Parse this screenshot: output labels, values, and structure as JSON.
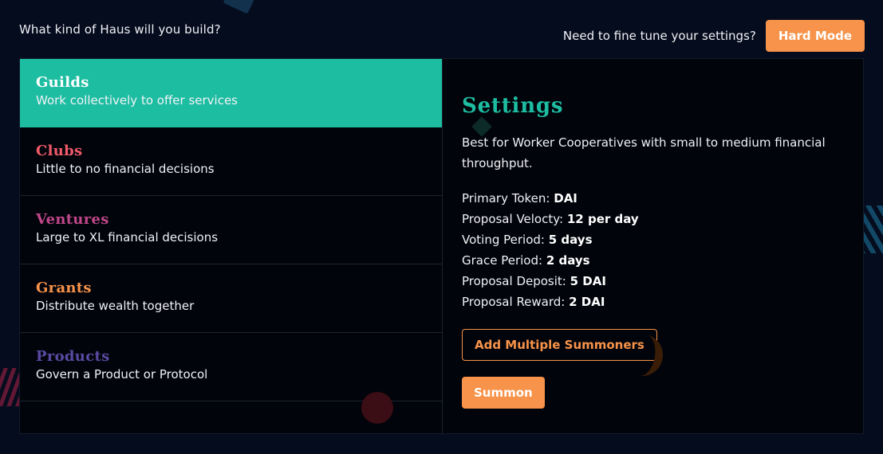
{
  "header": {
    "question": "What kind of Haus will you build?",
    "finetune_prompt": "Need to fine tune your settings?",
    "hard_mode_label": "Hard Mode"
  },
  "colors": {
    "background": "#050c1d",
    "accent_teal": "#1dbda2",
    "accent_orange": "#f7934a",
    "clubs": "#f05a6b",
    "ventures": "#c0478a",
    "grants": "#f7934a",
    "products": "#5a4aa3"
  },
  "haus_types": [
    {
      "title": "Guilds",
      "description": "Work collectively to offer services",
      "color": "#ffffff",
      "selected": true
    },
    {
      "title": "Clubs",
      "description": "Little to no financial decisions",
      "color": "#f05a6b",
      "selected": false
    },
    {
      "title": "Ventures",
      "description": "Large to XL financial decisions",
      "color": "#c0478a",
      "selected": false
    },
    {
      "title": "Grants",
      "description": "Distribute wealth together",
      "color": "#f7934a",
      "selected": false
    },
    {
      "title": "Products",
      "description": "Govern a Product or Protocol",
      "color": "#5a4aa3",
      "selected": false
    }
  ],
  "settings": {
    "title": "Settings",
    "description": "Best for Worker Cooperatives with small to medium financial throughput.",
    "params": [
      {
        "label": "Primary Token:",
        "value": "DAI"
      },
      {
        "label": "Proposal Velocty:",
        "value": "12 per day"
      },
      {
        "label": "Voting Period:",
        "value": "5 days"
      },
      {
        "label": "Grace Period:",
        "value": "2 days"
      },
      {
        "label": "Proposal Deposit:",
        "value": "5 DAI"
      },
      {
        "label": "Proposal Reward:",
        "value": "2 DAI"
      }
    ],
    "add_summoners_label": "Add Multiple Summoners",
    "summon_label": "Summon"
  }
}
